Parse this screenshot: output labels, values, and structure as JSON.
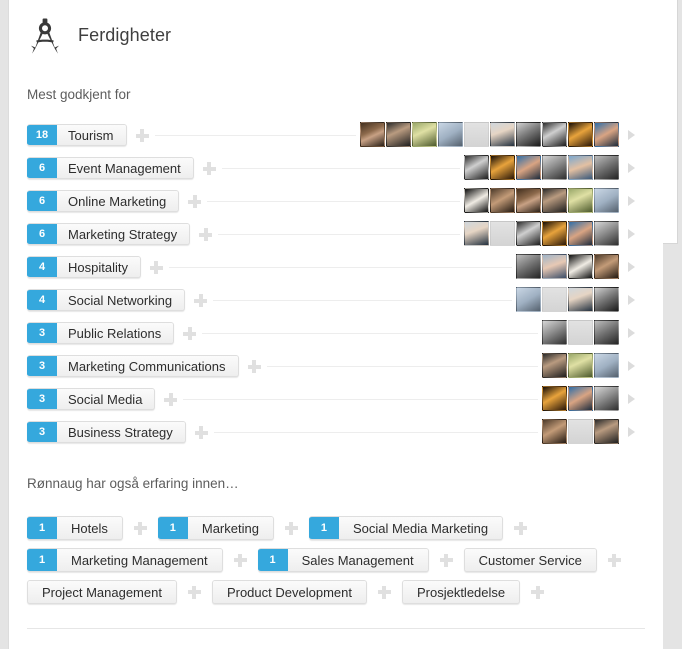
{
  "header": {
    "title": "Ferdigheter",
    "icon": "compass-divider-icon"
  },
  "sections": {
    "top_endorsed_label": "Mest godkjent for",
    "also_knows_label": "Rønnaug har også erfaring innen…"
  },
  "endorsements": [
    {
      "count": "18",
      "name": "Tourism",
      "avatars": 10
    },
    {
      "count": "6",
      "name": "Event Management",
      "avatars": 6
    },
    {
      "count": "6",
      "name": "Online Marketing",
      "avatars": 6
    },
    {
      "count": "6",
      "name": "Marketing Strategy",
      "avatars": 6
    },
    {
      "count": "4",
      "name": "Hospitality",
      "avatars": 4
    },
    {
      "count": "4",
      "name": "Social Networking",
      "avatars": 4
    },
    {
      "count": "3",
      "name": "Public Relations",
      "avatars": 3
    },
    {
      "count": "3",
      "name": "Marketing Communications",
      "avatars": 3
    },
    {
      "count": "3",
      "name": "Social Media",
      "avatars": 3
    },
    {
      "count": "3",
      "name": "Business Strategy",
      "avatars": 3
    }
  ],
  "also_knows": [
    [
      {
        "count": "1",
        "name": "Hotels"
      },
      {
        "count": "1",
        "name": "Marketing"
      },
      {
        "count": "1",
        "name": "Social Media Marketing"
      }
    ],
    [
      {
        "count": "1",
        "name": "Marketing Management"
      },
      {
        "count": "1",
        "name": "Sales Management"
      },
      {
        "count": "",
        "name": "Customer Service"
      }
    ],
    [
      {
        "count": "",
        "name": "Project Management"
      },
      {
        "count": "",
        "name": "Product Development"
      },
      {
        "count": "",
        "name": "Prosjektledelse"
      }
    ]
  ],
  "colors": {
    "badge_blue": "#35a8dd",
    "chip_background": "#f2f2f2",
    "card_background": "#ffffff",
    "page_background": "#e4e4e4",
    "text_primary": "#2d2d2d",
    "text_secondary": "#5d5d5d",
    "plus_icon": "#e0e0e0",
    "chevron_icon": "#dcdcdc"
  },
  "icons": {
    "add_skill": "plus-icon",
    "expand_endorsers": "chevron-right-icon"
  }
}
